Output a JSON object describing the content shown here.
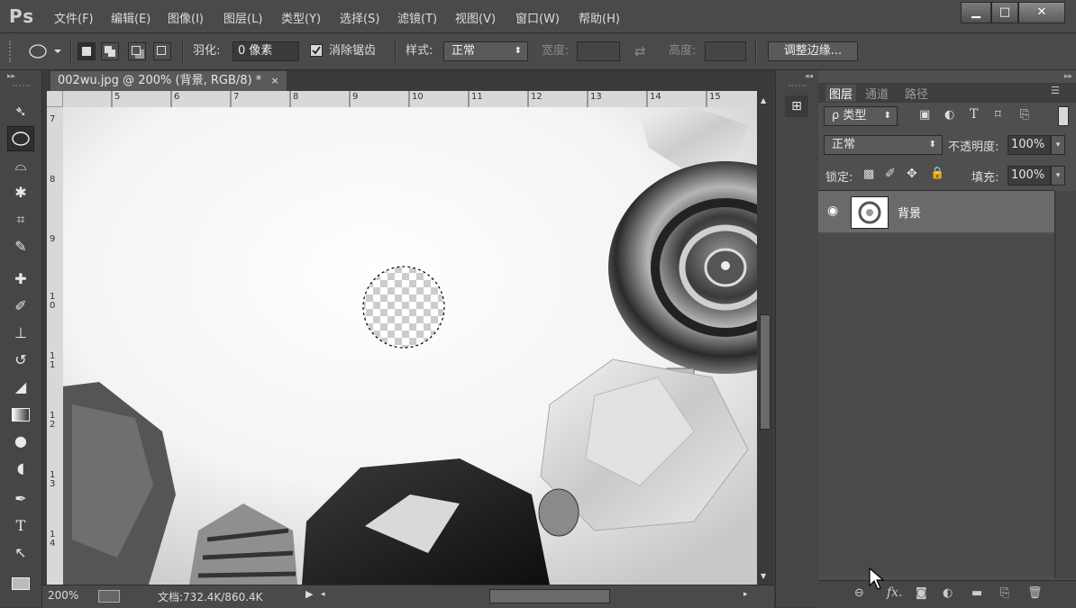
{
  "app": {
    "logo": "Ps"
  },
  "menu": [
    "文件(F)",
    "编辑(E)",
    "图像(I)",
    "图层(L)",
    "类型(Y)",
    "选择(S)",
    "滤镜(T)",
    "视图(V)",
    "窗口(W)",
    "帮助(H)"
  ],
  "window_buttons": {
    "minimize": "▁",
    "maximize": "□",
    "close": "✕"
  },
  "options": {
    "feather_label": "羽化:",
    "feather_value": "0 像素",
    "antialias_label": "消除锯齿",
    "antialias_checked": true,
    "style_label": "样式:",
    "style_value": "正常",
    "width_label": "宽度:",
    "height_label": "高度:",
    "refine_button": "调整边缘..."
  },
  "document": {
    "tab_title": "002wu.jpg @ 200% (背景, RGB/8) *",
    "tab_close": "×",
    "ruler_top": [
      "5",
      "6",
      "7",
      "8",
      "9",
      "10",
      "11",
      "12",
      "13",
      "14",
      "15"
    ],
    "ruler_left": [
      "7",
      "8",
      "9",
      "10",
      "11",
      "12",
      "13",
      "14"
    ]
  },
  "status": {
    "zoom": "200%",
    "doc_info": "文档:732.4K/860.4K"
  },
  "layers_panel": {
    "tabs": [
      "图层",
      "通道",
      "路径"
    ],
    "filter_label": "ρ 类型",
    "blend_mode": "正常",
    "opacity_label": "不透明度:",
    "opacity_value": "100%",
    "lock_label": "锁定:",
    "fill_label": "填充:",
    "fill_value": "100%",
    "layers": [
      {
        "name": "背景",
        "visible": true
      }
    ]
  },
  "icons": {
    "tools": [
      "move-icon",
      "elliptical-marquee-icon",
      "lasso-icon",
      "magic-wand-icon",
      "crop-icon",
      "eyedropper-icon",
      "healing-brush-icon",
      "brush-icon",
      "clone-stamp-icon",
      "history-brush-icon",
      "eraser-icon",
      "gradient-icon",
      "blur-icon",
      "dodge-icon",
      "pen-icon",
      "type-icon",
      "path-selection-icon",
      "rectangle-icon"
    ],
    "footer": [
      "link-layers-icon",
      "fx-icon",
      "layer-mask-icon",
      "adjustment-layer-icon",
      "group-folder-icon",
      "new-layer-icon",
      "trash-icon"
    ]
  }
}
